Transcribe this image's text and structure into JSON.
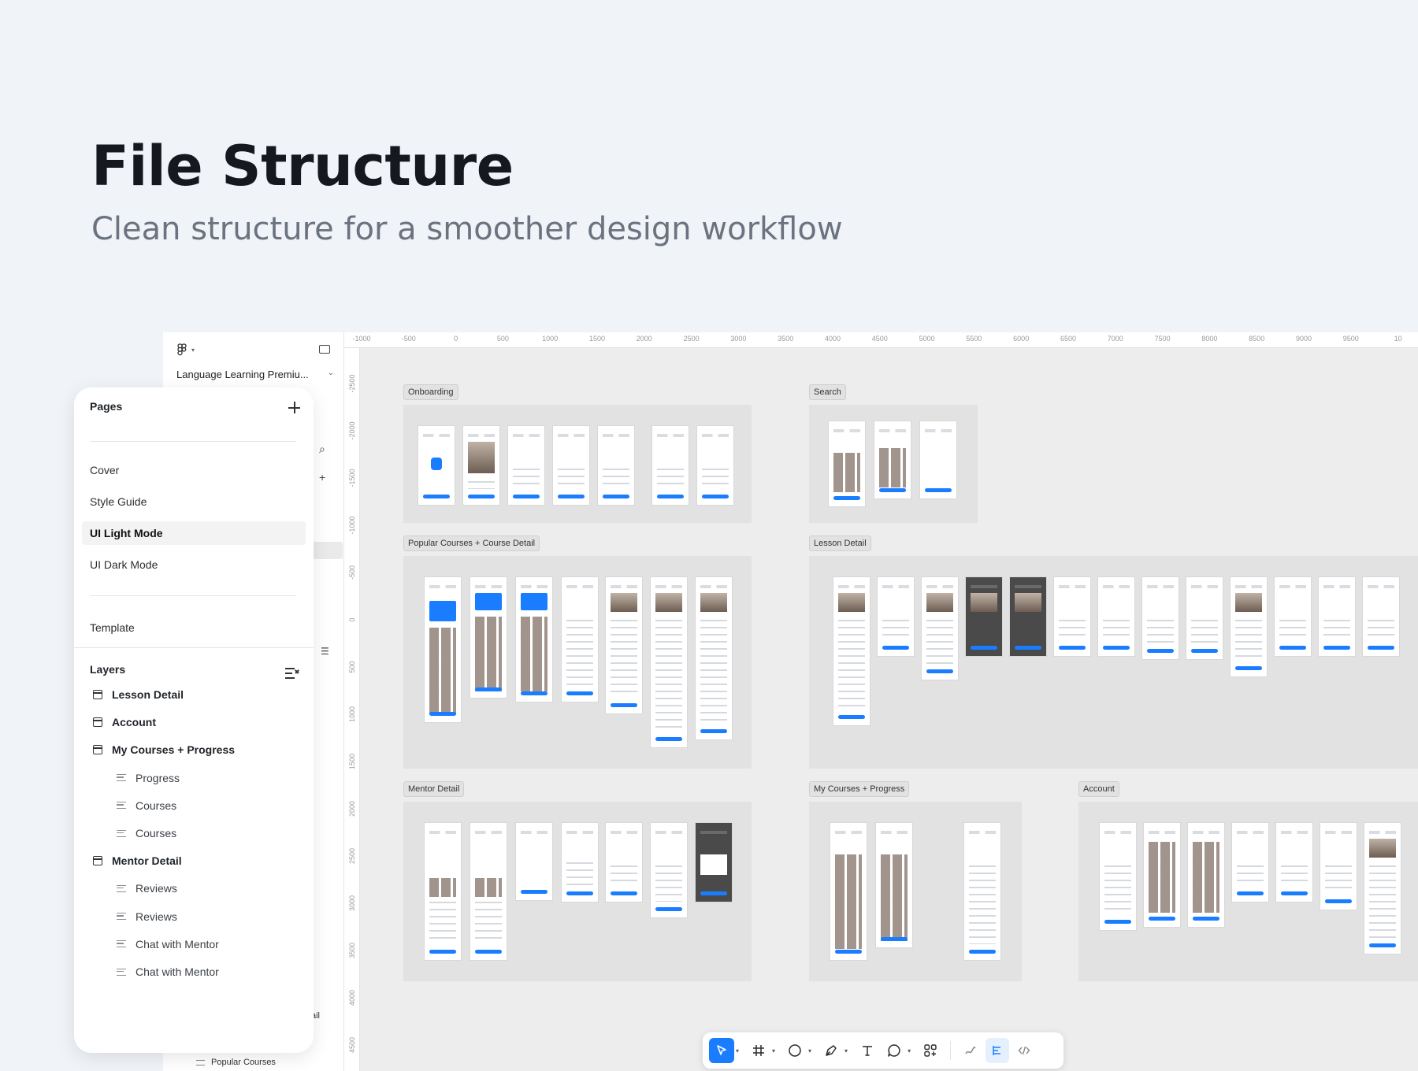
{
  "hero": {
    "title": "File Structure",
    "subtitle": "Clean structure for a smoother design workflow"
  },
  "file": {
    "name": "Language Learning Premiu..."
  },
  "ruler": {
    "x": [
      "-1000",
      "-500",
      "0",
      "500",
      "1000",
      "1500",
      "2000",
      "2500",
      "3000",
      "3500",
      "4000",
      "4500",
      "5000",
      "5500",
      "6000",
      "6500",
      "7000",
      "7500",
      "8000",
      "8500",
      "9000",
      "9500",
      "10"
    ],
    "y": [
      "-2500",
      "-2000",
      "-1500",
      "-1000",
      "-500",
      "0",
      "500",
      "1000",
      "1500",
      "2000",
      "2500",
      "3000",
      "3500",
      "4000",
      "4500"
    ]
  },
  "sections": {
    "onboarding": "Onboarding",
    "search": "Search",
    "popular": "Popular Courses + Course Detail",
    "lesson": "Lesson Detail",
    "mentor": "Mentor Detail",
    "mycourses": "My Courses + Progress",
    "account": "Account"
  },
  "pages": {
    "title": "Pages",
    "items": [
      "Cover",
      "Style Guide",
      "UI Light Mode",
      "UI Dark Mode",
      "Template"
    ],
    "active": "UI Light Mode"
  },
  "layers": {
    "title": "Layers",
    "items": [
      {
        "label": "Lesson Detail",
        "type": "parent"
      },
      {
        "label": "Account",
        "type": "parent"
      },
      {
        "label": "My Courses + Progress",
        "type": "parent"
      },
      {
        "label": "Progress",
        "type": "child"
      },
      {
        "label": "Courses",
        "type": "child"
      },
      {
        "label": "Courses",
        "type": "child"
      },
      {
        "label": "Mentor Detail",
        "type": "parent"
      },
      {
        "label": "Reviews",
        "type": "child"
      },
      {
        "label": "Reviews",
        "type": "child"
      },
      {
        "label": "Chat with Mentor",
        "type": "child"
      },
      {
        "label": "Chat with Mentor",
        "type": "child"
      }
    ]
  },
  "peek": {
    "detail": "ail",
    "popular": "Popular Courses"
  },
  "toolbar": {
    "tools": [
      "move-tool",
      "frame-tool",
      "shape-tool",
      "pen-tool",
      "text-tool",
      "comment-tool",
      "actions-tool",
      "draw-mode",
      "design-mode",
      "dev-mode"
    ]
  },
  "colors": {
    "background": "#f0f3f7",
    "accent": "#1a7dff",
    "canvas": "#ededed",
    "section": "#e2e2e2"
  }
}
